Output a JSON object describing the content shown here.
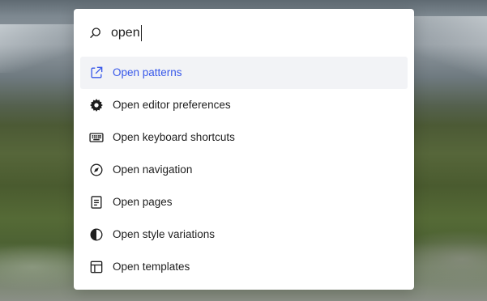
{
  "search": {
    "query": "open"
  },
  "commands": [
    {
      "label": "Open patterns",
      "icon": "external-link-icon",
      "active": true
    },
    {
      "label": "Open editor preferences",
      "icon": "gear-icon"
    },
    {
      "label": "Open keyboard shortcuts",
      "icon": "keyboard-icon"
    },
    {
      "label": "Open navigation",
      "icon": "compass-icon"
    },
    {
      "label": "Open pages",
      "icon": "page-icon"
    },
    {
      "label": "Open style variations",
      "icon": "half-circle-contrast-icon"
    },
    {
      "label": "Open templates",
      "icon": "layout-icon"
    }
  ],
  "colors": {
    "accent": "#3858e9",
    "active_bg": "#f2f3f6",
    "text": "#1e1e1e"
  }
}
